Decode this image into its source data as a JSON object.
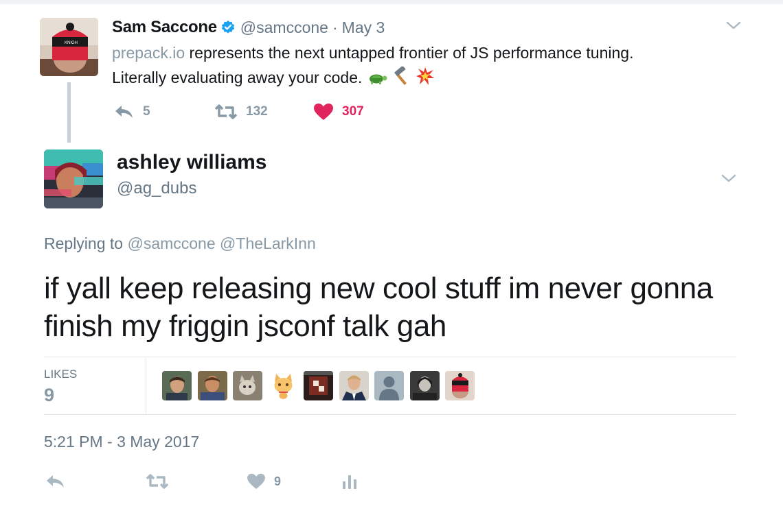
{
  "parent_tweet": {
    "author_name": "Sam Saccone",
    "handle": "@samccone",
    "separator": "·",
    "date": "May 3",
    "link_text": "prepack.io",
    "text_line1_rest": " represents the next untapped frontier of JS performance tuning.",
    "text_line2": "Literally evaluating away your code. ",
    "emojis": [
      "turtle-emoji",
      "hammer-emoji",
      "collision-emoji"
    ],
    "actions": {
      "reply_count": "5",
      "retweet_count": "132",
      "like_count": "307"
    },
    "colors": {
      "like_active": "#e0245e",
      "verified": "#1da1f2",
      "link": "#8899a6"
    }
  },
  "main_tweet": {
    "author_name": "ashley williams",
    "handle": "@ag_dubs",
    "replying_label": "Replying to",
    "reply_mentions": [
      "@samccone",
      "@TheLarkInn"
    ],
    "text": "if yall keep releasing new cool stuff im never gonna finish my friggin jsconf talk gah",
    "likes_label": "LIKES",
    "likes_count": "9",
    "liker_count_shown": 9,
    "timestamp": "5:21 PM - 3 May 2017",
    "actions": {
      "like_count": "9"
    }
  }
}
